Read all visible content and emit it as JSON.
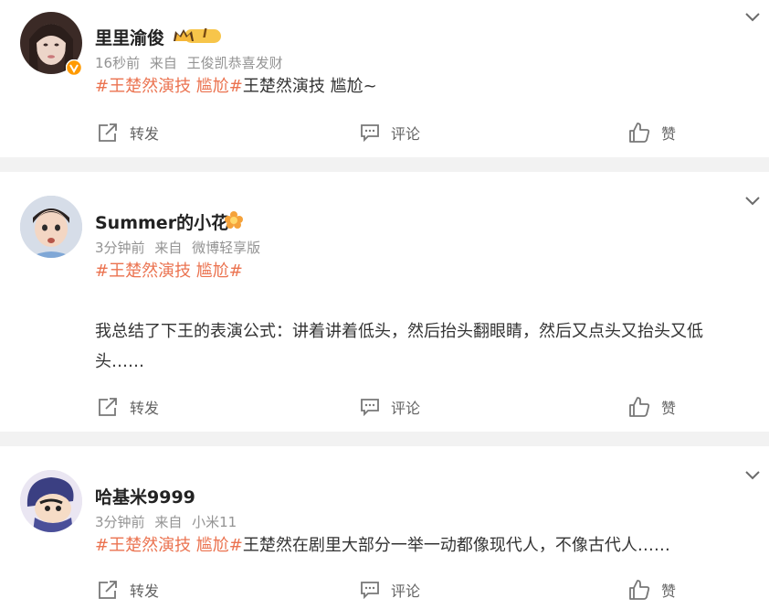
{
  "posts": [
    {
      "username": "里里渝俊",
      "time": "16秒前",
      "source_prefix": "来自",
      "source": "王俊凯恭喜发财",
      "tag": "#王楚然演技 尴尬#",
      "text": "王楚然演技 尴尬~",
      "level_badge": "I",
      "verified": true
    },
    {
      "username": "Summer的小花",
      "time": "3分钟前",
      "source_prefix": "来自",
      "source": "微博轻享版",
      "tag": "#王楚然演技 尴尬#",
      "text_line1": "我总结了下王的表演公式：讲着讲着低头，然后抬头翻眼睛，然后又点头又抬头又低",
      "text_line2": "头……"
    },
    {
      "username": "哈基米9999",
      "time": "3分钟前",
      "source_prefix": "来自",
      "source": "小米11",
      "tag": "#王楚然演技 尴尬#",
      "text": "王楚然在剧里大部分一举一动都像现代人，不像古代人……"
    }
  ],
  "actions": {
    "repost": "转发",
    "comment": "评论",
    "like": "赞"
  },
  "colors": {
    "tag": "#eb7350",
    "meta": "#939393",
    "divider": "#f2f2f2"
  },
  "icons": [
    "chevron-down-icon",
    "repost-icon",
    "comment-icon",
    "like-icon",
    "crown-badge-icon",
    "verified-icon",
    "flower-badge-icon"
  ]
}
